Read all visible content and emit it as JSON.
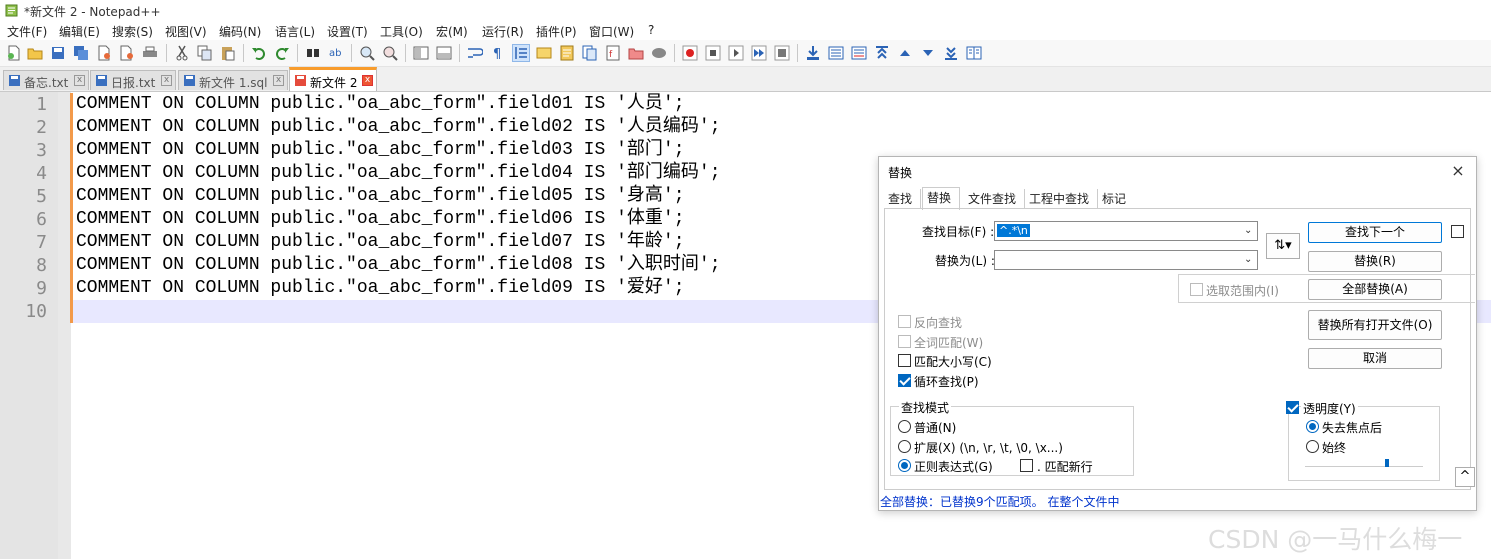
{
  "window": {
    "title": "*新文件 2 - Notepad++"
  },
  "menu": [
    "文件(F)",
    "编辑(E)",
    "搜索(S)",
    "视图(V)",
    "编码(N)",
    "语言(L)",
    "设置(T)",
    "工具(O)",
    "宏(M)",
    "运行(R)",
    "插件(P)",
    "窗口(W)",
    "?"
  ],
  "toolbar_icons": [
    "new-file-icon",
    "open-icon",
    "save-icon",
    "save-all-icon",
    "close-icon",
    "close-all-icon",
    "print-icon",
    "cut-icon",
    "copy-icon",
    "paste-icon",
    "undo-icon",
    "redo-icon",
    "find-icon",
    "replace-icon",
    "zoom-in-icon",
    "zoom-out-icon",
    "sync-v-icon",
    "sync-h-icon",
    "wrap-icon",
    "show-all-chars-icon",
    "indent-guide-icon",
    "udl-icon",
    "doc-map-icon",
    "doc-list-icon",
    "function-list-icon",
    "folder-icon",
    "monitor-icon",
    "record-icon",
    "stop-icon",
    "play-icon",
    "play-multi-icon",
    "save-macro-icon",
    "jump-icon",
    "compare-icon",
    "compare-next-icon",
    "first-diff-icon",
    "prev-diff-icon",
    "next-diff-icon",
    "last-diff-icon",
    "panel-icon"
  ],
  "tabs": [
    {
      "label": "备忘.txt",
      "active": false
    },
    {
      "label": "日报.txt",
      "active": false
    },
    {
      "label": "新文件 1.sql",
      "active": false
    },
    {
      "label": "新文件 2",
      "active": true
    }
  ],
  "editor": {
    "lines": [
      {
        "num": "1",
        "text": "COMMENT ON COLUMN public.\"oa_abc_form\".field01 IS '人员';"
      },
      {
        "num": "2",
        "text": "COMMENT ON COLUMN public.\"oa_abc_form\".field02 IS '人员编码';"
      },
      {
        "num": "3",
        "text": "COMMENT ON COLUMN public.\"oa_abc_form\".field03 IS '部门';"
      },
      {
        "num": "4",
        "text": "COMMENT ON COLUMN public.\"oa_abc_form\".field04 IS '部门编码';"
      },
      {
        "num": "5",
        "text": "COMMENT ON COLUMN public.\"oa_abc_form\".field05 IS '身高';"
      },
      {
        "num": "6",
        "text": "COMMENT ON COLUMN public.\"oa_abc_form\".field06 IS '体重';"
      },
      {
        "num": "7",
        "text": "COMMENT ON COLUMN public.\"oa_abc_form\".field07 IS '年龄';"
      },
      {
        "num": "8",
        "text": "COMMENT ON COLUMN public.\"oa_abc_form\".field08 IS '入职时间';"
      },
      {
        "num": "9",
        "text": "COMMENT ON COLUMN public.\"oa_abc_form\".field09 IS '爱好';"
      },
      {
        "num": "10",
        "text": ""
      }
    ]
  },
  "dialog": {
    "title": "替换",
    "close": "×",
    "tabs": [
      "查找",
      "替换",
      "文件查找",
      "工程中查找",
      "标记"
    ],
    "find_label": "查找目标(F) :",
    "find_value": "^.*\\n",
    "replace_label": "替换为(L) :",
    "replace_value": "",
    "swap": "⇅▾",
    "in_selection": "选取范围内(I)",
    "btn_find_next": "查找下一个",
    "btn_replace": "替换(R)",
    "btn_replace_all": "全部替换(A)",
    "btn_replace_all_open": "替换所有打开文件(O)",
    "btn_cancel": "取消",
    "opt_backward": "反向查找",
    "opt_whole_word": "全词匹配(W)",
    "opt_match_case": "匹配大小写(C)",
    "opt_wrap": "循环查找(P)",
    "search_mode_title": "查找模式",
    "mode_normal": "普通(N)",
    "mode_extended": "扩展(X) (\\n, \\r, \\t, \\0, \\x...)",
    "mode_regex": "正则表达式(G)",
    "dot_newline": ". 匹配新行",
    "transparency": "透明度(Y)",
    "trans_on_lose_focus": "失去焦点后",
    "trans_always": "始终",
    "transparency_level": 0.7,
    "collapse": "^",
    "status": "全部替换：已替换9个匹配项。 在整个文件中"
  },
  "watermark": "CSDN @一马什么梅一"
}
